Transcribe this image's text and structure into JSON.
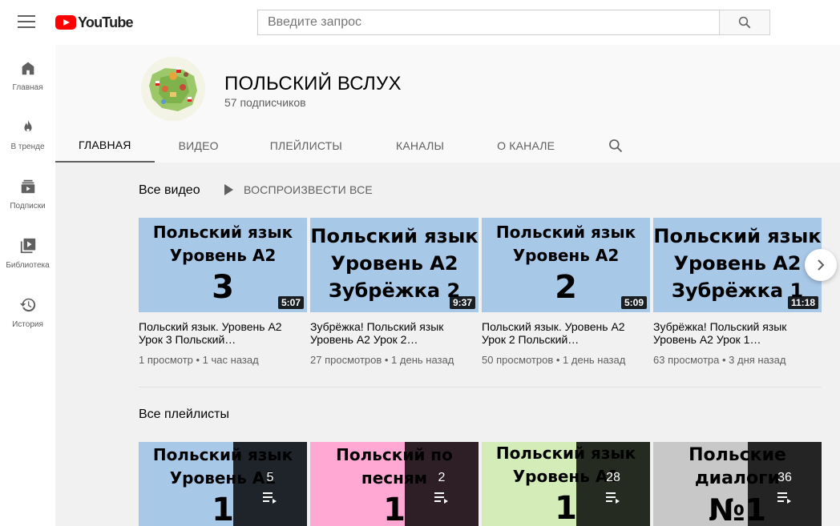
{
  "app": {
    "logo_text": "YouTube"
  },
  "search": {
    "placeholder": "Введите запрос"
  },
  "sidebar": {
    "items": [
      {
        "label": "Главная",
        "icon": "home-icon"
      },
      {
        "label": "В тренде",
        "icon": "fire-icon"
      },
      {
        "label": "Подписки",
        "icon": "subscriptions-icon"
      },
      {
        "label": "Библиотека",
        "icon": "library-icon"
      },
      {
        "label": "История",
        "icon": "history-icon"
      }
    ]
  },
  "channel": {
    "title": "ПОЛЬСКИЙ ВСЛУХ",
    "subscribers": "57 подписчиков",
    "tabs": [
      {
        "label": "ГЛАВНАЯ",
        "active": true
      },
      {
        "label": "ВИДЕО",
        "active": false
      },
      {
        "label": "ПЛЕЙЛИСТЫ",
        "active": false
      },
      {
        "label": "КАНАЛЫ",
        "active": false
      },
      {
        "label": "О КАНАЛЕ",
        "active": false
      }
    ]
  },
  "videos_section": {
    "title": "Все видео",
    "play_all": "ВОСПРОИЗВЕСТИ ВСЕ",
    "videos": [
      {
        "thumb_lines": [
          "Польский язык",
          "Уровень А2",
          "3"
        ],
        "duration": "5:07",
        "title": "Польский язык. Уровень А2 Урок 3 Польский…",
        "meta": "1 просмотр • 1 час назад",
        "bg": "#a8c8e8"
      },
      {
        "thumb_lines": [
          "Польский язык",
          "Уровень А2",
          "Зубрёжка 2"
        ],
        "duration": "9:37",
        "title": "Зубрёжка! Польский язык Уровень А2 Урок 2…",
        "meta": "27 просмотров • 1 день назад",
        "bg": "#a8c8e8"
      },
      {
        "thumb_lines": [
          "Польский язык",
          "Уровень А2",
          "2"
        ],
        "duration": "5:09",
        "title": "Польский язык. Уровень А2 Урок 2 Польский…",
        "meta": "50 просмотров • 1 день назад",
        "bg": "#a8c8e8"
      },
      {
        "thumb_lines": [
          "Польский язык",
          "Уровень А2",
          "Зубрёжка 1"
        ],
        "duration": "11:18",
        "title": "Зубрёжка! Польский язык Уровень А2 Урок 1…",
        "meta": "63 просмотра • 3 дня назад",
        "bg": "#a8c8e8"
      }
    ]
  },
  "playlists_section": {
    "title": "Все плейлисты",
    "playlists": [
      {
        "thumb_lines": [
          "Польский язык",
          "Уровень А1",
          "1"
        ],
        "count": "5",
        "bg": "#a8c8e8"
      },
      {
        "thumb_lines": [
          "Польский по",
          "песням",
          "1"
        ],
        "count": "2",
        "bg": "#ffa8d4"
      },
      {
        "thumb_lines": [
          "Польский язык",
          "Уровень А1",
          "1"
        ],
        "count": "28",
        "bg": "#d4ecb8"
      },
      {
        "thumb_lines": [
          "Польские",
          "диалоги",
          "№1"
        ],
        "count": "36",
        "bg": "#c8c8c8"
      }
    ]
  }
}
